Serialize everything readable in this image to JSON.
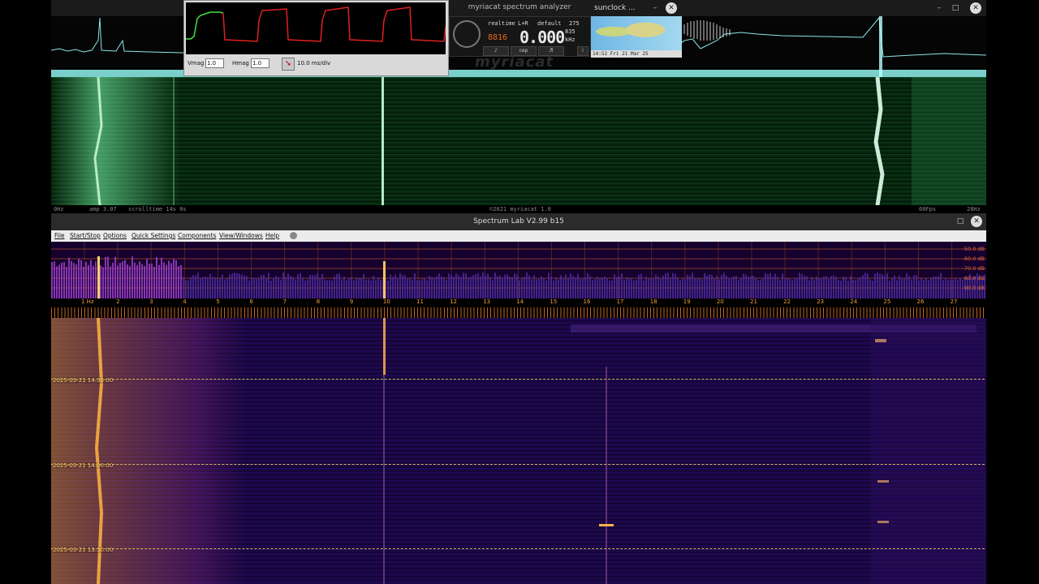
{
  "myriacat": {
    "title": "myriacat spectrum analyzer",
    "status": {
      "left_freq": "0Hz",
      "amp": "amp 3.07",
      "scrolltime": "scrolltime 14s 0s",
      "copyright": "©2021 myriacat 1.0",
      "fps": "60Fps",
      "right_freq": "28Hz"
    },
    "watermark": "myriacat",
    "radio": {
      "mode": "realtime",
      "channel": "L+R",
      "preset": "default",
      "value_275": "275",
      "small_digits": "8816",
      "frequency": "0.000",
      "sub_value": "835",
      "unit": "kHz",
      "buttons": [
        "♪",
        "cep",
        "♬"
      ],
      "info_button": "i"
    }
  },
  "scope": {
    "vmag_label": "Vmag",
    "vmag_value": "1.0",
    "hmag_label": "Hmag",
    "hmag_value": "1.0",
    "timebase": "10.0 ms/div",
    "trace_colors": {
      "green": "#46e046",
      "red": "#e02020"
    }
  },
  "sunclock": {
    "title": "sunclock ...",
    "time": "14:52 Fri 21 Mar 25"
  },
  "spectrumlab": {
    "title": "Spectrum Lab V2.99 b15",
    "menu": [
      "File",
      "Start/Stop",
      "Options",
      "Quick Settings",
      "Components",
      "View/Windows",
      "Help"
    ],
    "db_labels": [
      "-50.0 dB",
      "-60.0 dB",
      "-70.0 dB",
      "-80.0 dB",
      "-90.0 dB"
    ],
    "axis_labels": [
      "1 Hz",
      "2",
      "3",
      "4",
      "5",
      "6",
      "7",
      "8",
      "9",
      "10",
      "11",
      "12",
      "13",
      "14",
      "15",
      "16",
      "17",
      "18",
      "19",
      "20",
      "21",
      "22",
      "23",
      "24",
      "25",
      "26",
      "27"
    ],
    "timestamps": [
      "2025-03-21 14:30:00",
      "2025-03-21 14:00:00",
      "2025-03-21 13:30:00"
    ]
  }
}
